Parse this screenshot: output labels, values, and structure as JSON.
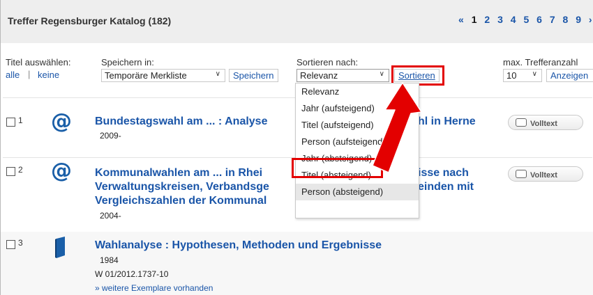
{
  "header": {
    "title": "Treffer Regensburger Katalog (182)",
    "pager": {
      "first": "«",
      "current": "1",
      "pages": [
        "2",
        "3",
        "4",
        "5",
        "6",
        "7",
        "8",
        "9"
      ],
      "next": "›"
    }
  },
  "controls": {
    "titel_label": "Titel auswählen:",
    "alle": "alle",
    "divider": "|",
    "keine": "keine",
    "save_label": "Speichern in:",
    "save_select": "Temporäre Merkliste",
    "save_button": "Speichern",
    "sort_label": "Sortieren nach:",
    "sort_select": "Relevanz",
    "sort_button": "Sortieren",
    "max_label": "max. Trefferanzahl",
    "max_select": "10",
    "show_button": "Anzeigen"
  },
  "sort_options": [
    "Relevanz",
    "Jahr (aufsteigend)",
    "Titel (aufsteigend)",
    "Person (aufsteigend)",
    "Jahr (absteigend)",
    "Titel (absteigend)",
    "Person (absteigend)"
  ],
  "results": [
    {
      "num": "1",
      "title": "Bundestagswahl am ... : Analyse",
      "title_after": "hl in Herne",
      "year": "2009-",
      "fulltext": "Volltext"
    },
    {
      "num": "2",
      "title_l1": "Kommunalwahlen am ... in Rhei",
      "title_l1_after": "isse nach",
      "title_l2": "Verwaltungskreisen, Verbandsge",
      "title_l2_after": "einden mit",
      "title_l3": "Vergleichszahlen der Kommunal",
      "year": "2004-",
      "fulltext": "Volltext"
    },
    {
      "num": "3",
      "title": "Wahlanalyse : Hypothesen, Methoden und Ergebnisse",
      "year": "1984",
      "signature": "W 01/2012.1737-10",
      "more_link": "» weitere Exemplare vorhanden"
    }
  ],
  "colors": {
    "link": "#1a55a8",
    "highlight": "#e30000",
    "header_bg": "#eeeeee"
  }
}
